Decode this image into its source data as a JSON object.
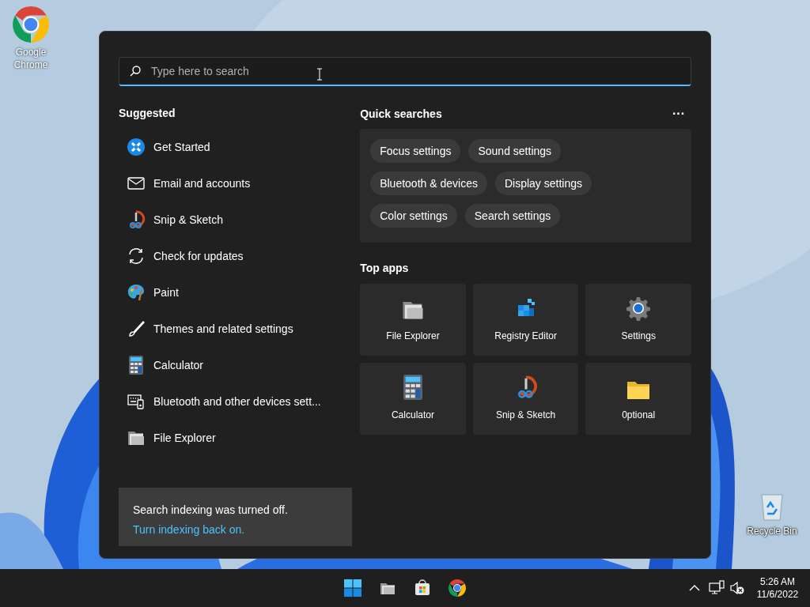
{
  "desktop_icons": [
    {
      "label": "Google Chrome"
    },
    {
      "label": "Recycle Bin"
    }
  ],
  "search": {
    "placeholder": "Type here to search"
  },
  "suggested": {
    "title": "Suggested",
    "items": [
      {
        "label": "Get Started"
      },
      {
        "label": "Email and accounts"
      },
      {
        "label": "Snip & Sketch"
      },
      {
        "label": "Check for updates"
      },
      {
        "label": "Paint"
      },
      {
        "label": "Themes and related settings"
      },
      {
        "label": "Calculator"
      },
      {
        "label": "Bluetooth and other devices sett..."
      },
      {
        "label": "File Explorer"
      }
    ]
  },
  "notice": {
    "text": "Search indexing was turned off.",
    "link": "Turn indexing back on."
  },
  "quick_searches": {
    "title": "Quick searches",
    "more": "···",
    "rows": [
      [
        "Focus settings",
        "Sound settings"
      ],
      [
        "Bluetooth & devices",
        "Display settings"
      ],
      [
        "Color settings",
        "Search settings"
      ]
    ]
  },
  "top_apps": {
    "title": "Top apps",
    "items": [
      {
        "label": "File Explorer"
      },
      {
        "label": "Registry Editor"
      },
      {
        "label": "Settings"
      },
      {
        "label": "Calculator"
      },
      {
        "label": "Snip & Sketch"
      },
      {
        "label": "0ptional"
      }
    ]
  },
  "clock": {
    "time": "5:26 AM",
    "date": "11/6/2022"
  }
}
